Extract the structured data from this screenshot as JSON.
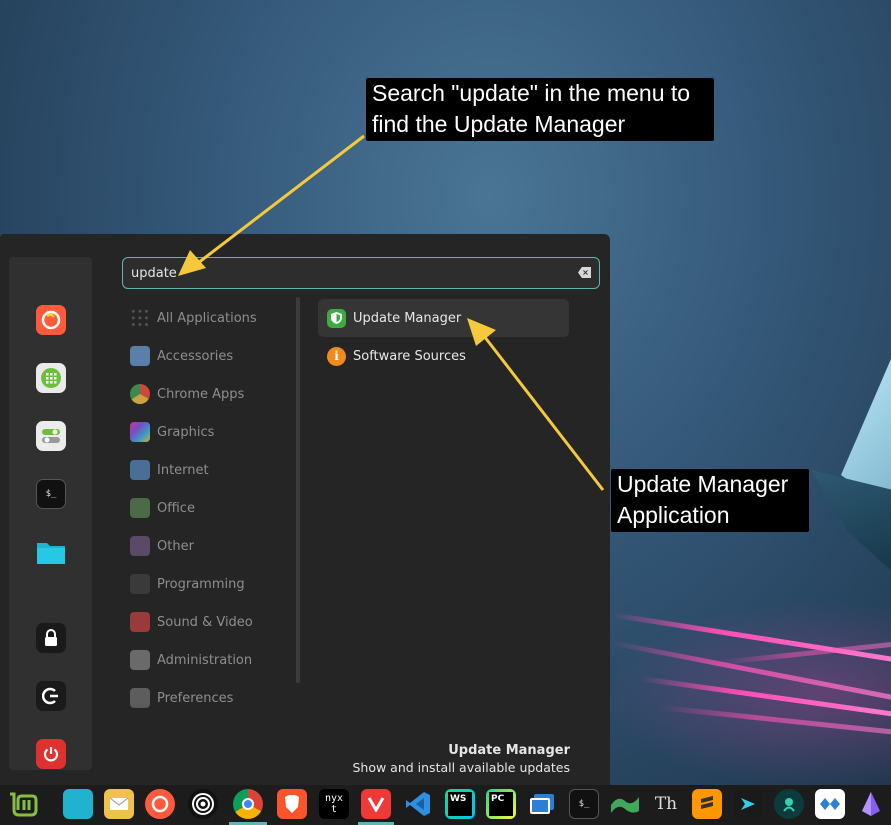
{
  "search": {
    "value": "update"
  },
  "categories": [
    {
      "label": "All Applications",
      "icon": "grid-icon"
    },
    {
      "label": "Accessories",
      "icon": "scissors-icon"
    },
    {
      "label": "Chrome Apps",
      "icon": "chrome-icon"
    },
    {
      "label": "Graphics",
      "icon": "graphics-icon"
    },
    {
      "label": "Internet",
      "icon": "cloud-icon"
    },
    {
      "label": "Office",
      "icon": "office-icon"
    },
    {
      "label": "Other",
      "icon": "other-icon"
    },
    {
      "label": "Programming",
      "icon": "programming-icon"
    },
    {
      "label": "Sound & Video",
      "icon": "play-icon"
    },
    {
      "label": "Administration",
      "icon": "admin-icon"
    },
    {
      "label": "Preferences",
      "icon": "preferences-icon"
    }
  ],
  "results": [
    {
      "label": "Update Manager",
      "icon": "shield-icon",
      "color": "#3faa3f"
    },
    {
      "label": "Software Sources",
      "icon": "info-icon",
      "color": "#f08a1c"
    }
  ],
  "footer": {
    "title": "Update Manager",
    "description": "Show and install available updates"
  },
  "callouts": {
    "search_tip": "Search \"update\" in the menu to find the Update Manager",
    "app_tip": "Update Manager Application"
  },
  "favorites": [
    "firefox-icon",
    "calculator-icon",
    "settings-icon",
    "terminal-icon",
    "files-icon",
    "lock-icon",
    "logout-icon",
    "power-icon"
  ],
  "taskbar_terminal_label": "$_",
  "taskbar_ws_label": "WS",
  "taskbar_pc_label": "PC",
  "taskbar_nyxt_label": "nyxt",
  "taskbar_th_label": "Th",
  "colors": {
    "accent": "#5fb5b0",
    "menu_bg": "#252525",
    "callout_bg": "#000000",
    "arrow": "#f5c93c"
  }
}
